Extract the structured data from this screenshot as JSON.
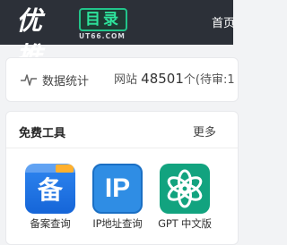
{
  "header": {
    "logo_text": "优推",
    "logo_badge": "目录",
    "logo_domain": "UT66.COM",
    "nav_home": "首页"
  },
  "stats": {
    "icon": "pulse-icon",
    "title": "数据统计",
    "site_label": "网站",
    "site_count": "48501",
    "pending_text": "个(待审:1"
  },
  "tools": {
    "title": "免费工具",
    "more": "更多",
    "items": [
      {
        "label": "备案查询",
        "icon": "beian-icon",
        "glyph": "备"
      },
      {
        "label": "IP地址查询",
        "icon": "ip-icon",
        "glyph": "IP"
      },
      {
        "label": "GPT 中文版",
        "icon": "openai-icon"
      }
    ]
  },
  "colors": {
    "header_bg": "#2c3038",
    "badge_green": "#2ee39c",
    "beian_blue": "#1f77e6",
    "ip_blue": "#2f8de4",
    "gpt_green": "#12a37f"
  }
}
